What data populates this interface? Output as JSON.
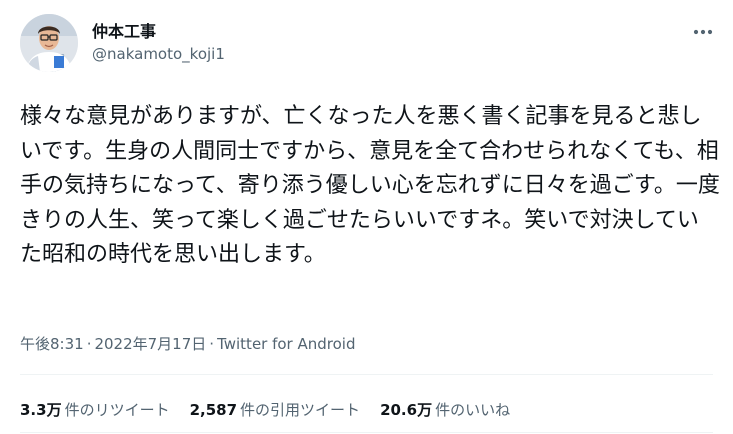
{
  "user": {
    "display_name": "仲本工事",
    "handle": "@nakamoto_koji1"
  },
  "tweet": {
    "text": "様々な意見がありますが、亡くなった人を悪く書く記事を見ると悲しいです。生身の人間同士ですから、意見を全て合わせられなくても、相手の気持ちになって、寄り添う優しい心を忘れずに日々を過ごす。一度きりの人生、笑って楽しく過ごせたらいいですネ。笑いで対決していた昭和の時代を思い出します。"
  },
  "meta": {
    "time": "午後8:31",
    "separator": "·",
    "date": "2022年7月17日",
    "source": "Twitter for Android"
  },
  "stats": {
    "retweets": {
      "count": "3.3万",
      "label": "件のリツイート"
    },
    "quotes": {
      "count": "2,587",
      "label": "件の引用ツイート"
    },
    "likes": {
      "count": "20.6万",
      "label": "件のいいね"
    }
  },
  "icons": {
    "avatar": "user-avatar",
    "more": "more-horizontal-icon"
  },
  "colors": {
    "text_primary": "#0f1419",
    "text_secondary": "#536471",
    "divider": "#eff3f4"
  }
}
